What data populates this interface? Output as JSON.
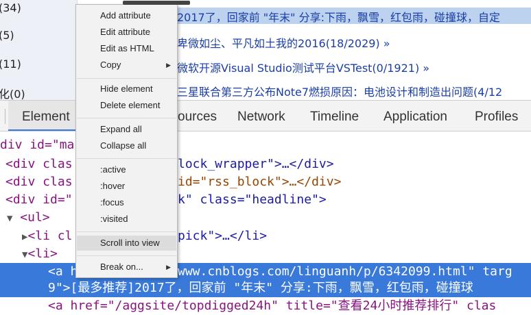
{
  "web": {
    "categories": [
      "(34)",
      "(5)",
      "(11)",
      "化(0)"
    ],
    "selected_text": "2017了，回家前 \"年末\" 分享:下雨，飘雪，红包雨，碰撞球，自定",
    "articles": [
      "卑微如尘、平凡如土我的2016(18/2029) »",
      "微软开源Visual Studio测试平台VSTest(0/1921) »",
      "三星联合第三方公布Note7燃损原因：电池设计和制造出问题(4/12"
    ]
  },
  "devtools": {
    "tabs": [
      "Elements",
      "Sources",
      "Network",
      "Timeline",
      "Application",
      "Profiles"
    ],
    "tabs_visible": [
      "Element",
      "ources",
      "Network",
      "Timeline",
      "Application",
      "Profiles"
    ],
    "lines": {
      "l0": "div id=\"ma",
      "l1a": "<div clas",
      "l1b": "lock_wrapper\">…</div>",
      "l2a": "<div clas",
      "l2b": "id=\"rss_block\">…</div>",
      "l3a": "<div id=\"",
      "l3b": "k\" class=\"headline\">",
      "l4": "<ul>",
      "l5a": "<li cl",
      "l5b": "pick\">…</li>",
      "l6": "<li>",
      "l7a": "<a h",
      "l7b": "www.cnblogs.com/linguanh/p/6342099.html\" targ",
      "l8": "9\">[最多推荐]2017了，回家前 \"年末\" 分享:下雨，飘雪，红包雨，碰撞球",
      "l9": "<a href=\"/aggsite/topdigged24h\" title=\"查看24小时推荐排行\" clas"
    }
  },
  "menu": {
    "items": [
      {
        "label": "Add attribute"
      },
      {
        "label": "Edit attribute"
      },
      {
        "label": "Edit as HTML"
      },
      {
        "label": "Copy",
        "submenu": true
      },
      {
        "label": "Hide element"
      },
      {
        "label": "Delete element"
      },
      {
        "label": "Expand all"
      },
      {
        "label": "Collapse all"
      },
      {
        "label": ":active"
      },
      {
        "label": ":hover"
      },
      {
        "label": ":focus"
      },
      {
        "label": ":visited"
      },
      {
        "label": "Scroll into view",
        "highlighted": true
      },
      {
        "label": "Break on...",
        "submenu": true
      }
    ]
  },
  "colors": {
    "selection": "#3879d9",
    "tag": "#881280",
    "attr": "#994500",
    "value": "#1a1aa6",
    "link": "#1a3ea8"
  }
}
